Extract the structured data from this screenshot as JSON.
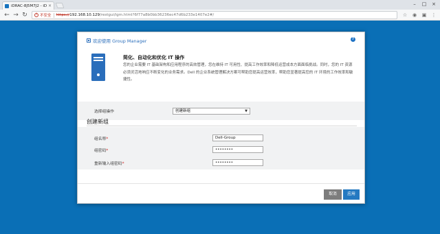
{
  "browser": {
    "tab_title": "iDRAC-8J5M7J2 - iDRA",
    "url_insecure_label": "不安全",
    "url_scheme": "https://",
    "url_host": "192.168.10.129",
    "url_path": "/restgui/igm.html?6f77a8b0bb36236ec47d6b233e1407e2#/"
  },
  "dialog": {
    "title": "欢迎使用 Group Manager",
    "intro_heading": "简化、自动化和优化 IT 操作",
    "intro_text": "您的企业需要 IT 基础架构和应用程序的高效管理，您在维持 IT 可用性、提高工作效率和降低运营成本方面面临挑战。同时，您的 IT 资源必须灵活地响应不断变化的业务需求。Dell 的企业系统管理解决方案可帮助您提高运营效率，帮助您显著提高您的 IT 环境的工作效率和敏捷性。",
    "action_label": "选择组操作",
    "action_selected": "创建新组",
    "section_title": "创建新组",
    "fields": {
      "group_name_label": "组名称",
      "group_name_value": "Dell-Group",
      "password_label": "组密码",
      "password_value": "••••••••",
      "confirm_label": "重新输入组密码",
      "confirm_value": "••••••••"
    },
    "required_mark": "*",
    "cancel_label": "取消",
    "apply_label": "应用"
  },
  "colors": {
    "page_background": "#0a6fb6",
    "accent": "#2579c1",
    "cancel": "#7d7d7d",
    "required": "#d0312d"
  },
  "icons": [
    "back-icon",
    "forward-icon",
    "reload-icon",
    "warning-icon",
    "star-icon",
    "extension-icon",
    "menu-icon",
    "help-icon",
    "server-icon"
  ]
}
